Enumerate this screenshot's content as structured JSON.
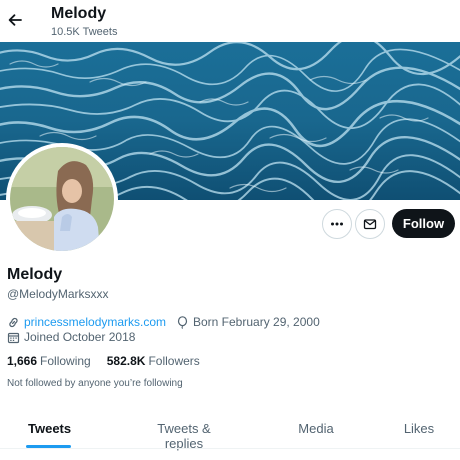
{
  "header": {
    "title": "Melody",
    "tweet_count": "10.5K Tweets"
  },
  "profile": {
    "name": "Melody",
    "handle": "@MelodyMarksxxx",
    "website": "princessmelodymarks.com",
    "birthday": "Born February 29, 2000",
    "joined": "Joined October 2018",
    "following_count": "1,666",
    "following_label": "Following",
    "followers_count": "582.8K",
    "followers_label": "Followers",
    "mutuals_note": "Not followed by anyone you’re following"
  },
  "actions": {
    "follow_label": "Follow"
  },
  "tabs": [
    {
      "label": "Tweets",
      "active": true
    },
    {
      "label": "Tweets & replies",
      "active": false
    },
    {
      "label": "Media",
      "active": false
    },
    {
      "label": "Likes",
      "active": false
    }
  ],
  "colors": {
    "accent": "#1d9bf0",
    "text": "#0f1419",
    "muted": "#536471",
    "follow_button": "#0f1419"
  },
  "icons": {
    "back": "back-arrow-icon",
    "more": "more-dots-icon",
    "message": "mail-icon",
    "website": "link-icon",
    "birthday": "balloon-icon",
    "joined": "calendar-icon"
  }
}
